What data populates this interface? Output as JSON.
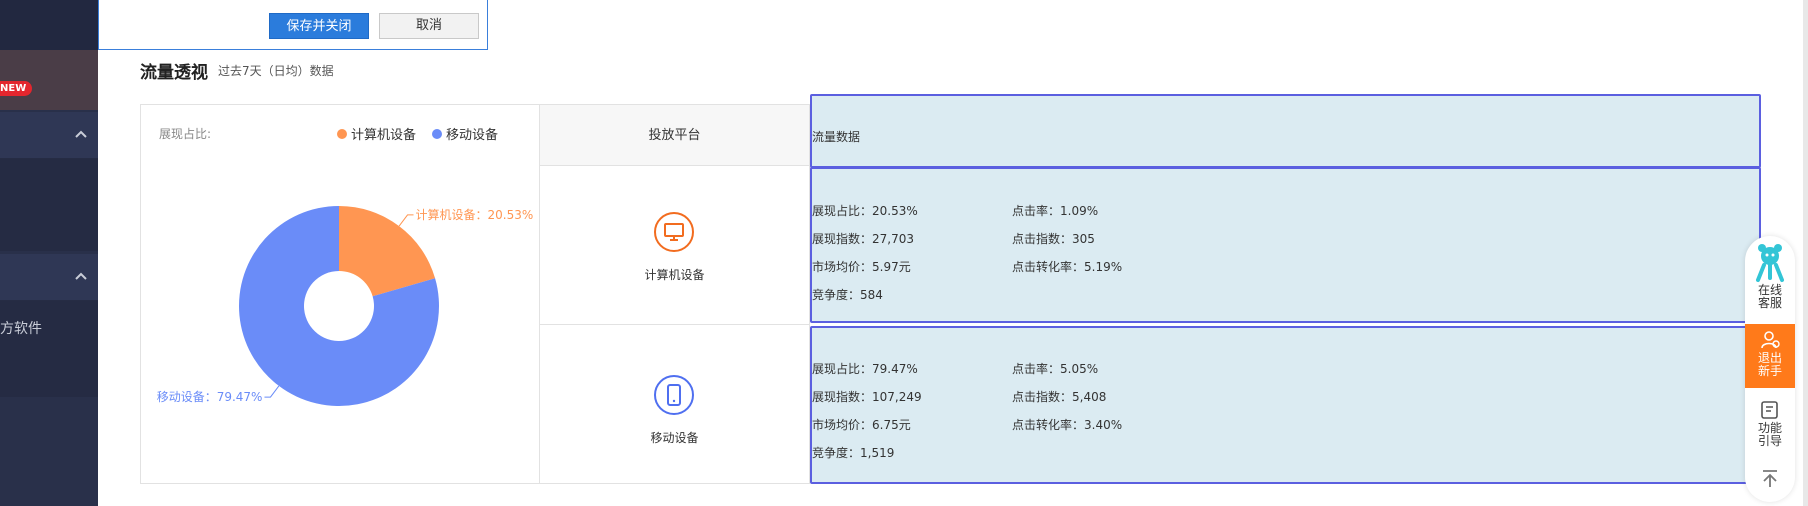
{
  "dialog": {
    "save_label": "保存并关闭",
    "cancel_label": "取消"
  },
  "sidebar": {
    "new_badge": "NEW",
    "partial_label": "方软件"
  },
  "section": {
    "title": "流量透视",
    "subtitle": "过去7天（日均）数据"
  },
  "chart_data": {
    "type": "pie",
    "variant": "donut",
    "label": "展现占比:",
    "categories": [
      "计算机设备",
      "移动设备"
    ],
    "values": [
      20.53,
      79.47
    ],
    "unit": "%",
    "colors": [
      "#ff9652",
      "#6a8cf8"
    ],
    "slice_labels": [
      "计算机设备：20.53%",
      "移动设备：79.47%"
    ],
    "legend_position": "top-right"
  },
  "table": {
    "header_platform": "投放平台",
    "header_data": "流量数据",
    "rows": [
      {
        "device": "计算机设备",
        "icon": "desktop-icon",
        "color": "#f26c1f",
        "metrics_left": [
          "展现占比：20.53%",
          "展现指数：27,703",
          "市场均价：5.97元",
          "竞争度：584"
        ],
        "metrics_right": [
          "点击率：1.09%",
          "点击指数：305",
          "点击转化率：5.19%"
        ]
      },
      {
        "device": "移动设备",
        "icon": "mobile-icon",
        "color": "#4f6ff0",
        "metrics_left": [
          "展现占比：79.47%",
          "展现指数：107,249",
          "市场均价：6.75元",
          "竞争度：1,519"
        ],
        "metrics_right": [
          "点击率：5.05%",
          "点击指数：5,408",
          "点击转化率：3.40%"
        ]
      }
    ]
  },
  "float_bar": {
    "service_label_1": "在线",
    "service_label_2": "客服",
    "exit_label_1": "退出",
    "exit_label_2": "新手",
    "guide_label_1": "功能",
    "guide_label_2": "引导"
  }
}
